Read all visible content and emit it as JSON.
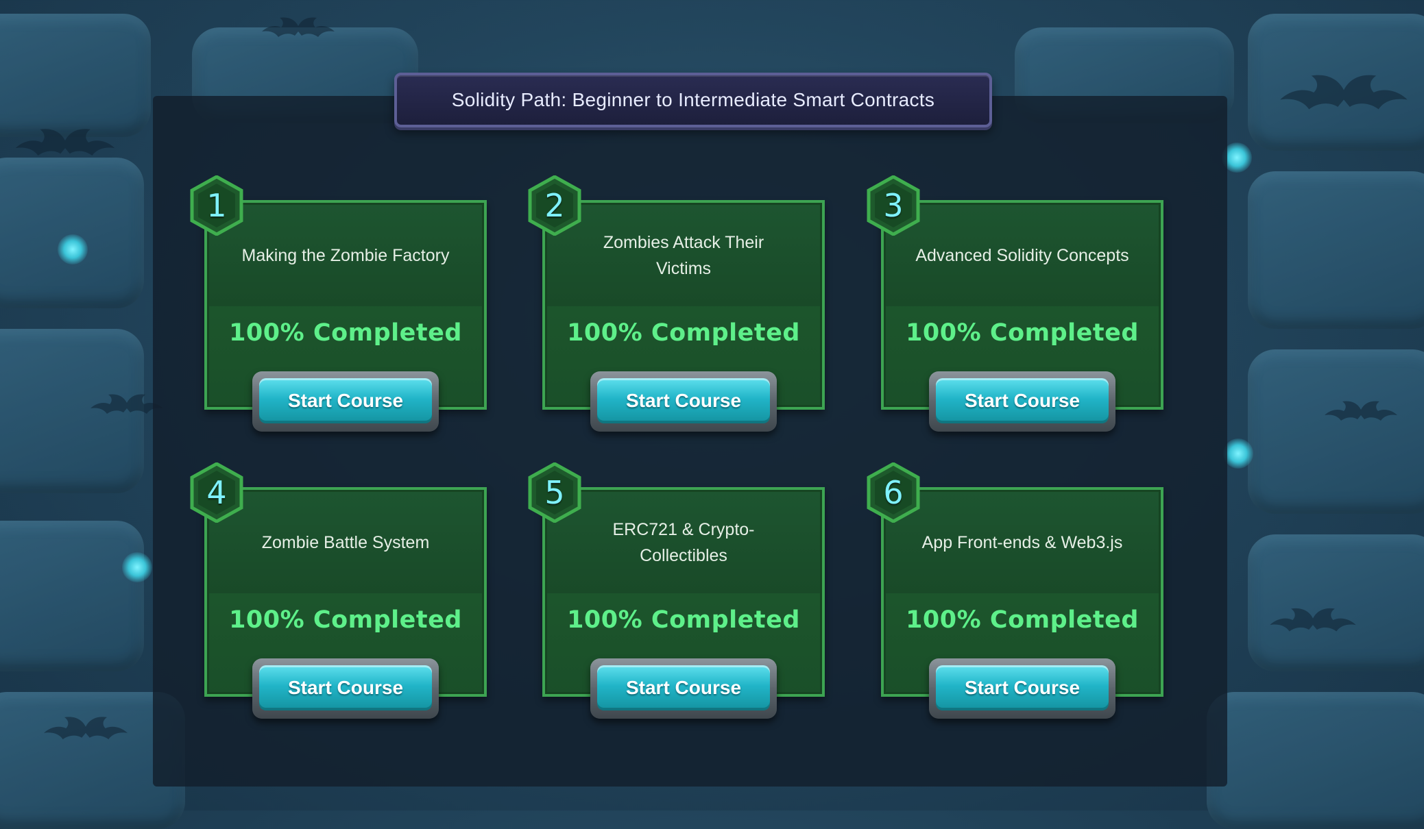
{
  "path_title": "Solidity Path: Beginner to Intermediate Smart Contracts",
  "colors": {
    "card_border": "#3da452",
    "progress_text": "#5ef08a",
    "badge_number": "#7ff2ff",
    "button_fill": "#21b5c8"
  },
  "courses": [
    {
      "number": "1",
      "title": "Making the Zombie Factory",
      "progress": "100% Completed",
      "progress_value": 100,
      "button_label": "Start Course"
    },
    {
      "number": "2",
      "title": "Zombies Attack Their Victims",
      "progress": "100% Completed",
      "progress_value": 100,
      "button_label": "Start Course"
    },
    {
      "number": "3",
      "title": "Advanced Solidity Concepts",
      "progress": "100% Completed",
      "progress_value": 100,
      "button_label": "Start Course"
    },
    {
      "number": "4",
      "title": "Zombie Battle System",
      "progress": "100% Completed",
      "progress_value": 100,
      "button_label": "Start Course"
    },
    {
      "number": "5",
      "title": "ERC721 & Crypto-Collectibles",
      "progress": "100% Completed",
      "progress_value": 100,
      "button_label": "Start Course"
    },
    {
      "number": "6",
      "title": "App Front-ends & Web3.js",
      "progress": "100% Completed",
      "progress_value": 100,
      "button_label": "Start Course"
    }
  ]
}
